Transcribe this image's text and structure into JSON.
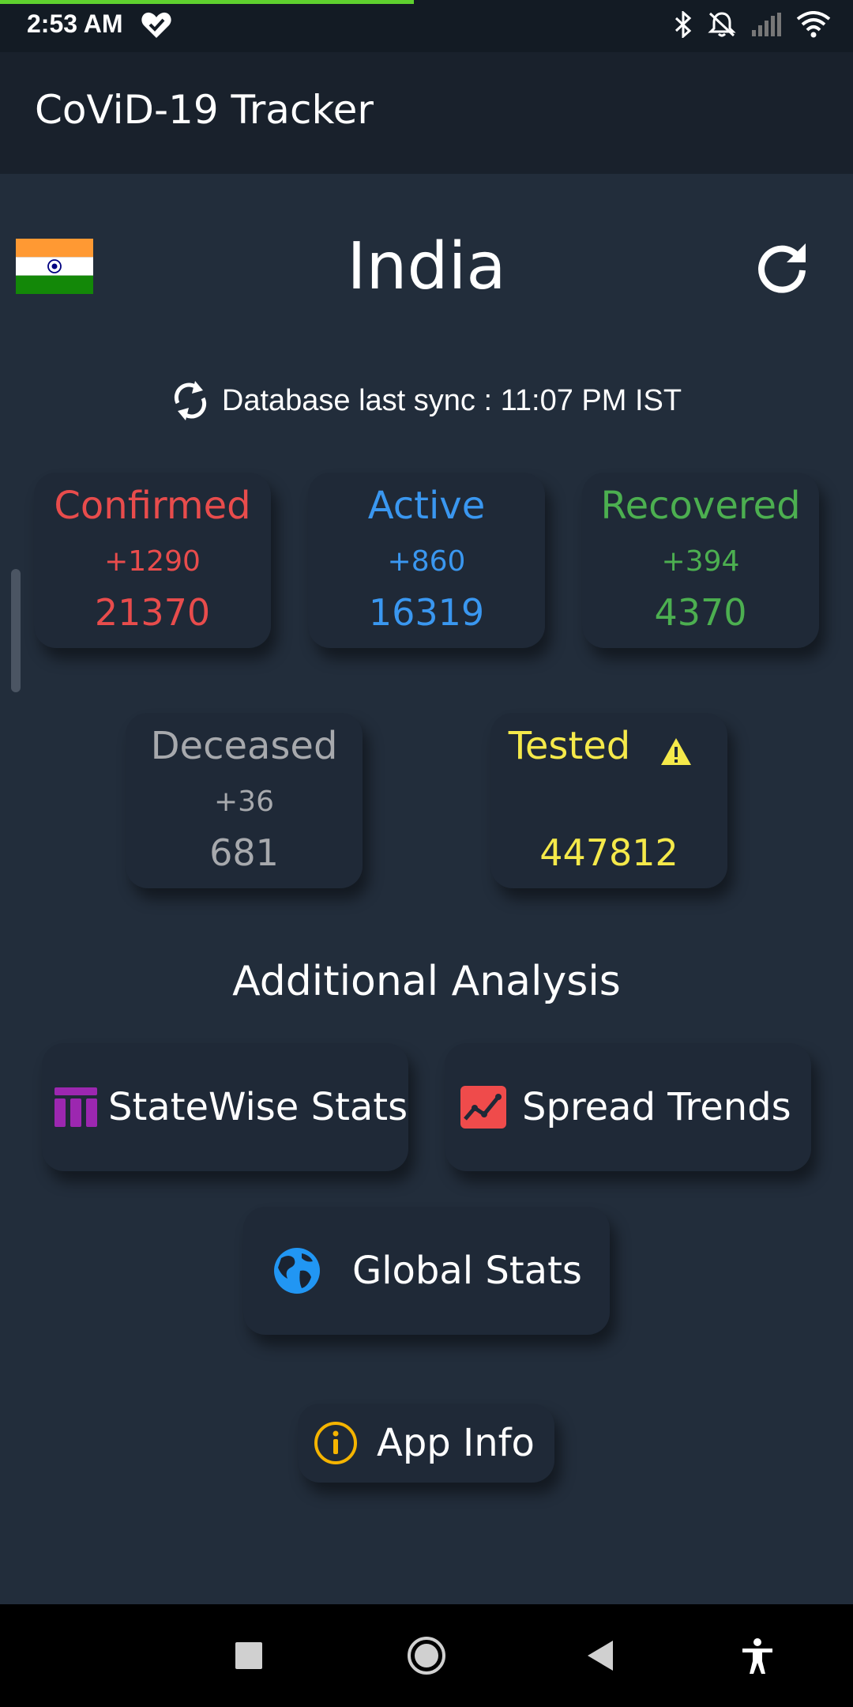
{
  "status_bar": {
    "time": "2:53 AM",
    "progress_fraction": 0.485,
    "icons": [
      "heart-check-icon",
      "bluetooth-icon",
      "notifications-off-icon",
      "signal-icon",
      "wifi-icon"
    ]
  },
  "app_bar": {
    "title": "CoViD-19 Tracker"
  },
  "country": {
    "name": "India",
    "flag_icon": "india-flag-icon",
    "refresh_icon": "refresh-icon"
  },
  "sync": {
    "text": "Database last sync : 11:07 PM IST"
  },
  "stats": {
    "confirmed": {
      "label": "Confirmed",
      "delta": "+1290",
      "total": "21370",
      "color": "#e84c4c"
    },
    "active": {
      "label": "Active",
      "delta": "+860",
      "total": "16319",
      "color": "#3a97f0"
    },
    "recovered": {
      "label": "Recovered",
      "delta": "+394",
      "total": "4370",
      "color": "#4caf50"
    },
    "deceased": {
      "label": "Deceased",
      "delta": "+36",
      "total": "681",
      "color": "#a7a9ad"
    },
    "tested": {
      "label": "Tested",
      "total": "447812",
      "color": "#f5e94a"
    }
  },
  "analysis": {
    "title": "Additional Analysis",
    "statewise_label": "StateWise Stats",
    "trends_label": "Spread Trends",
    "global_label": "Global Stats",
    "appinfo_label": "App Info"
  },
  "colors": {
    "background": "#222d3b",
    "card": "#1f2937",
    "app_bar": "#19212c"
  }
}
